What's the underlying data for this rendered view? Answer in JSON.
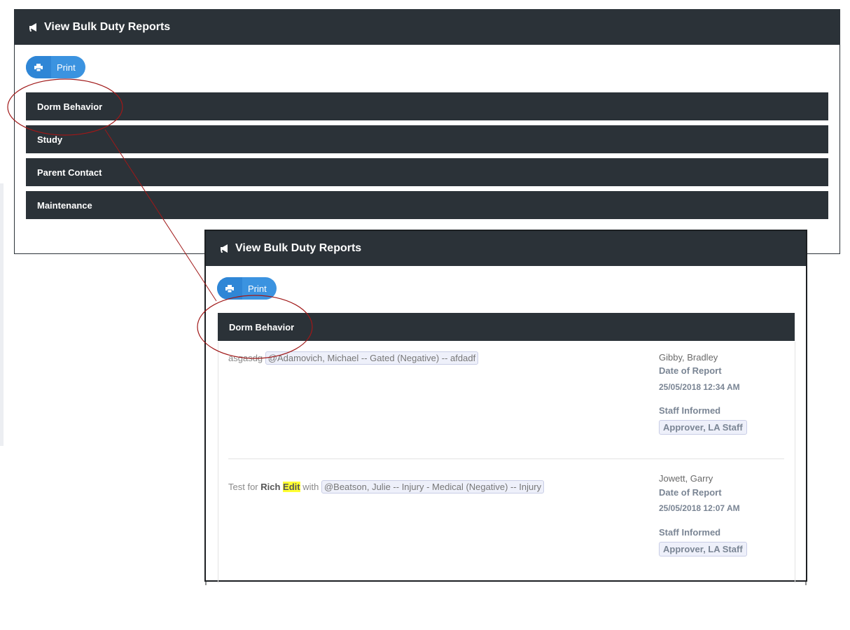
{
  "back_panel": {
    "title": "View Bulk Duty Reports",
    "print_label": "Print",
    "sections": [
      "Dorm Behavior",
      "Study",
      "Parent Contact",
      "Maintenance"
    ]
  },
  "front_panel": {
    "title": "View Bulk Duty Reports",
    "print_label": "Print",
    "section": "Dorm Behavior",
    "reports": [
      {
        "text_prefix": "asgasdg",
        "mention": "@Adamovich, Michael -- Gated (Negative) -- afdadf",
        "author": "Gibby, Bradley",
        "date_label": "Date of Report",
        "date": "25/05/2018 12:34 AM",
        "staff_label": "Staff Informed",
        "staff": "Approver, LA Staff"
      },
      {
        "text_part1": "Test for ",
        "text_bold": "Rich",
        "text_highlight": "Edit",
        "text_part2": " with ",
        "mention": "@Beatson, Julie -- Injury - Medical (Negative) -- Injury",
        "author": "Jowett, Garry",
        "date_label": "Date of Report",
        "date": "25/05/2018 12:07 AM",
        "staff_label": "Staff Informed",
        "staff": "Approver, LA Staff"
      }
    ]
  },
  "colors": {
    "header_bg": "#2b3238",
    "print_btn": "#3b93e0",
    "annotation": "#a01818",
    "highlight": "#ffff33"
  }
}
